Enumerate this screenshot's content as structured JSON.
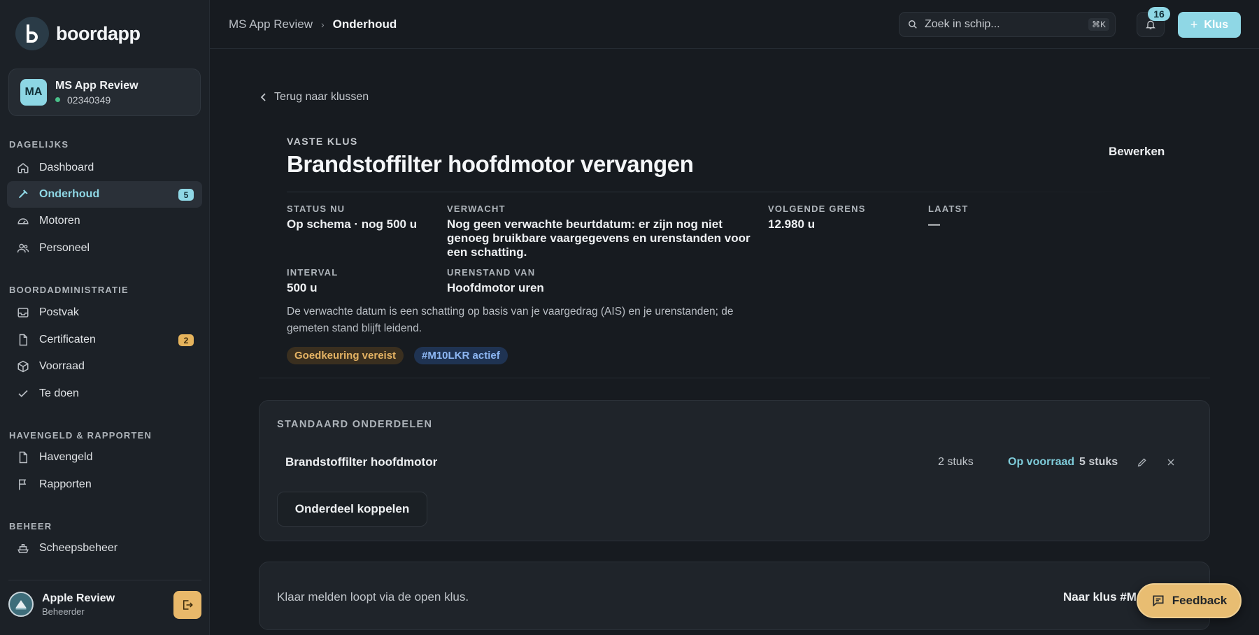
{
  "brand": {
    "name": "boordapp"
  },
  "account": {
    "initials": "MA",
    "name": "MS App Review",
    "number": "02340349"
  },
  "nav": {
    "sections": [
      {
        "title": "DAGELIJKS"
      },
      {
        "title": "BOORDADMINISTRATIE"
      },
      {
        "title": "HAVENGELD & RAPPORTEN"
      },
      {
        "title": "BEHEER"
      }
    ],
    "items": [
      {
        "label": "Dashboard",
        "icon": "home-icon"
      },
      {
        "label": "Onderhoud",
        "icon": "wrench-icon",
        "badge": "5",
        "active": true
      },
      {
        "label": "Motoren",
        "icon": "gauge-icon"
      },
      {
        "label": "Personeel",
        "icon": "users-icon"
      },
      {
        "label": "Postvak",
        "icon": "inbox-icon"
      },
      {
        "label": "Certificaten",
        "icon": "file-icon",
        "badge": "2"
      },
      {
        "label": "Voorraad",
        "icon": "box-icon"
      },
      {
        "label": "Te doen",
        "icon": "check-icon"
      },
      {
        "label": "Havengeld",
        "icon": "file-icon"
      },
      {
        "label": "Rapporten",
        "icon": "flag-icon"
      },
      {
        "label": "Scheepsbeheer",
        "icon": "ship-icon"
      }
    ]
  },
  "user": {
    "name": "Apple Review",
    "role": "Beheerder"
  },
  "topbar": {
    "breadcrumb": {
      "parent": "MS App Review",
      "current": "Onderhoud"
    },
    "search": {
      "placeholder": "Zoek in schip...",
      "shortcut": "⌘K"
    },
    "notifications": "16",
    "new_button": "Klus"
  },
  "task": {
    "back_label": "Terug naar klussen",
    "kind": "VASTE KLUS",
    "title": "Brandstoffilter hoofdmotor vervangen",
    "edit_label": "Bewerken",
    "meta": {
      "status_label": "STATUS NU",
      "status_value": "Op schema · nog 500 u",
      "expected_label": "VERWACHT",
      "expected_value": "Nog geen verwachte beurtdatum: er zijn nog niet genoeg bruikbare vaargegevens en urenstanden voor een schatting.",
      "next_label": "VOLGENDE GRENS",
      "next_value": "12.980 u",
      "last_label": "LAATST",
      "last_value": "—",
      "interval_label": "INTERVAL",
      "interval_value": "500 u",
      "hours_label": "URENSTAND VAN",
      "hours_value": "Hoofdmotor uren"
    },
    "note": "De verwachte datum is een schatting op basis van je vaargedrag (AIS) en je urenstanden; de gemeten stand blijft leidend.",
    "tags": {
      "approval": "Goedkeuring vereist",
      "active": "#M10LKR actief"
    }
  },
  "parts": {
    "title": "STANDAARD ONDERDELEN",
    "items": [
      {
        "name": "Brandstoffilter hoofdmotor",
        "qty": "2 stuks",
        "stock_status": "Op voorraad",
        "stock_qty": "5 stuks"
      }
    ],
    "link_button": "Onderdeel koppelen"
  },
  "done": {
    "text": "Klaar melden loopt via de open klus.",
    "link": "Naar klus #M"
  },
  "feedback": "Feedback",
  "colors": {
    "accent": "#8fd7e5",
    "warning": "#e5b35c",
    "background": "#171b20"
  }
}
